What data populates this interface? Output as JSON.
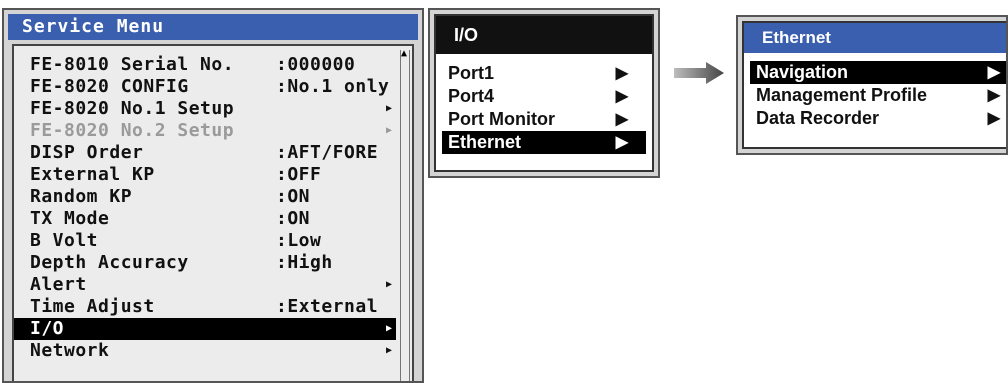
{
  "service_menu": {
    "title": "Service Menu",
    "items": [
      {
        "label": "FE-8010 Serial No.",
        "value": ":000000",
        "arrow": ""
      },
      {
        "label": "FE-8020 CONFIG",
        "value": ":No.1 only",
        "arrow": ""
      },
      {
        "label": "FE-8020 No.1 Setup",
        "value": "",
        "arrow": "▶"
      },
      {
        "label": "FE-8020 No.2 Setup",
        "value": "",
        "arrow": "▶"
      },
      {
        "label": "DISP Order",
        "value": ":AFT/FORE",
        "arrow": ""
      },
      {
        "label": "External KP",
        "value": ":OFF",
        "arrow": ""
      },
      {
        "label": "Random KP",
        "value": ":ON",
        "arrow": ""
      },
      {
        "label": "TX Mode",
        "value": ":ON",
        "arrow": ""
      },
      {
        "label": "B Volt",
        "value": ":Low",
        "arrow": ""
      },
      {
        "label": "Depth Accuracy",
        "value": ":High",
        "arrow": ""
      },
      {
        "label": "Alert",
        "value": "",
        "arrow": "▶"
      },
      {
        "label": "Time Adjust",
        "value": ":External",
        "arrow": ""
      },
      {
        "label": "I/O",
        "value": "",
        "arrow": "▶"
      },
      {
        "label": "Network",
        "value": "",
        "arrow": "▶"
      }
    ]
  },
  "io_menu": {
    "title": "I/O",
    "items": [
      {
        "label": "Port1",
        "arrow": "▶"
      },
      {
        "label": "Port4",
        "arrow": "▶"
      },
      {
        "label": "Port Monitor",
        "arrow": "▶"
      },
      {
        "label": "Ethernet",
        "arrow": "▶"
      }
    ]
  },
  "ethernet_menu": {
    "title": "Ethernet",
    "items": [
      {
        "label": "Navigation",
        "arrow": "▶"
      },
      {
        "label": "Management Profile",
        "arrow": "▶"
      },
      {
        "label": "Data Recorder",
        "arrow": "▶"
      }
    ]
  },
  "colors": {
    "title_bar": "#3a5fae",
    "selection": "#000000",
    "disabled": "#9a9a9a"
  },
  "icons": {
    "submenu": "triangle-right-icon",
    "flow": "right-arrow-icon"
  }
}
